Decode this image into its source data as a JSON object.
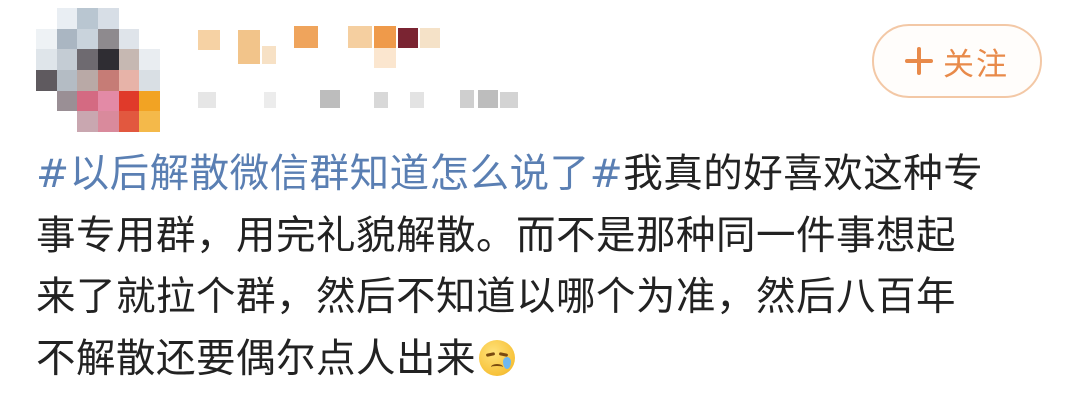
{
  "header": {
    "follow_label": "关注"
  },
  "post": {
    "topic": "#以后解散微信群知道怎么说了#",
    "lines": [
      "我真的好喜欢这种专",
      "事专用群，用完礼貌解散。而不是那种同一件事想起",
      "来了就拉个群，然后不知道以哪个为准，然后八百年",
      "不解散还要偶尔点人出来"
    ],
    "emoji": "sad-tear-emoji"
  },
  "colors": {
    "topic": "#5a7fb3",
    "text": "#222222",
    "accent": "#e88a4a",
    "follow_border": "#f3c8a6"
  }
}
